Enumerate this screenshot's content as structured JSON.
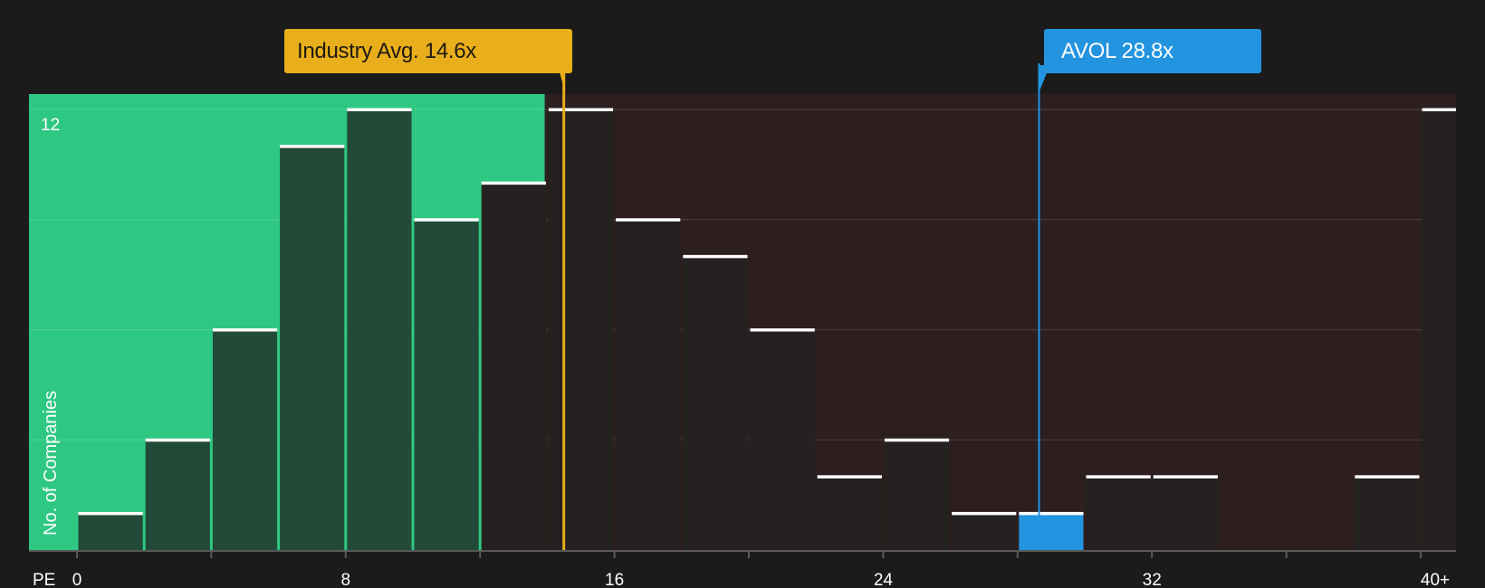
{
  "chart_data": {
    "type": "bar",
    "xlabel": "PE",
    "ylabel": "No. of Companies",
    "bin_width": 2,
    "x_range": [
      0,
      40
    ],
    "ylim": [
      0,
      12
    ],
    "x_ticks": [
      "0",
      "8",
      "16",
      "24",
      "32",
      "40+"
    ],
    "y_ticks": [
      "12"
    ],
    "bins": [
      {
        "start": 0,
        "value": 1
      },
      {
        "start": 2,
        "value": 3
      },
      {
        "start": 4,
        "value": 6
      },
      {
        "start": 6,
        "value": 11
      },
      {
        "start": 8,
        "value": 12
      },
      {
        "start": 10,
        "value": 9
      },
      {
        "start": 12,
        "value": 10
      },
      {
        "start": 14,
        "value": 12
      },
      {
        "start": 16,
        "value": 9
      },
      {
        "start": 18,
        "value": 8
      },
      {
        "start": 20,
        "value": 6
      },
      {
        "start": 22,
        "value": 2
      },
      {
        "start": 24,
        "value": 3
      },
      {
        "start": 26,
        "value": 1
      },
      {
        "start": 28,
        "value": 1,
        "highlight": true
      },
      {
        "start": 30,
        "value": 2
      },
      {
        "start": 32,
        "value": 2
      },
      {
        "start": 34,
        "value": 0
      },
      {
        "start": 36,
        "value": 0
      },
      {
        "start": 38,
        "value": 2
      },
      {
        "start": 40,
        "value": 12
      }
    ],
    "industry_avg": {
      "label": "Industry Avg. 14.6x",
      "value": 14.6
    },
    "company": {
      "label": "AVOL 28.8x",
      "value": 28.8
    },
    "grid": true
  },
  "colors": {
    "background": "#1b1b1b",
    "undervalued_zone": "#2ec882",
    "overvalued_zone": "#2d1e1f",
    "bar_in_green": "#224a38",
    "bar_dark": "#242120",
    "bar_top": "#ffffff",
    "highlight_bar": "#2294e0",
    "industry": "#e9ae1c",
    "company": "#2294e0"
  }
}
